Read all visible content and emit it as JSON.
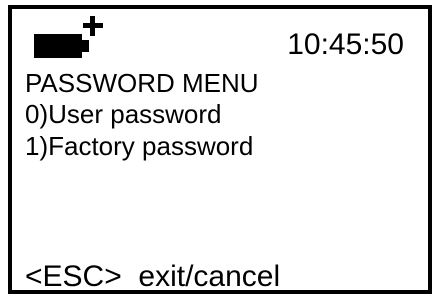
{
  "status_bar": {
    "battery_icon": "battery-icon",
    "charging_icon": "plus-icon",
    "time": "10:45:50"
  },
  "menu": {
    "title": "PASSWORD MENU",
    "items": [
      {
        "label": "0)User password"
      },
      {
        "label": "1)Factory password"
      }
    ]
  },
  "footer": {
    "hint": "<ESC>  exit/cancel"
  }
}
